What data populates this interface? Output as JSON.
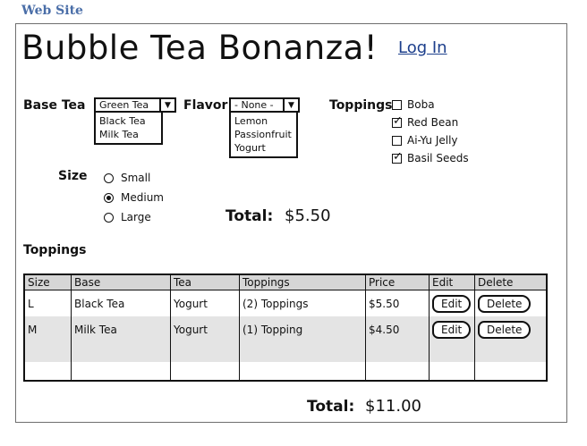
{
  "caption": "Web Site",
  "header": {
    "title": "Bubble Tea Bonanza!",
    "login": "Log In"
  },
  "form": {
    "base_tea": {
      "label": "Base Tea",
      "selected": "Green Tea",
      "options": [
        "Black Tea",
        "Milk Tea"
      ]
    },
    "flavor": {
      "label": "Flavor",
      "selected": "- None -",
      "options": [
        "Lemon",
        "Passionfruit",
        "Yogurt"
      ]
    },
    "toppings": {
      "label": "Toppings",
      "items": [
        {
          "label": "Boba",
          "checked": false
        },
        {
          "label": "Red Bean",
          "checked": true
        },
        {
          "label": "Ai-Yu Jelly",
          "checked": false
        },
        {
          "label": "Basil Seeds",
          "checked": true
        }
      ]
    },
    "size": {
      "label": "Size",
      "options": [
        {
          "label": "Small",
          "selected": false
        },
        {
          "label": "Medium",
          "selected": true
        },
        {
          "label": "Large",
          "selected": false
        }
      ]
    },
    "total_label": "Total:",
    "total_value": "$5.50"
  },
  "order": {
    "section_label": "Toppings",
    "columns": [
      "Size",
      "Base",
      "Tea",
      "Toppings",
      "Price",
      "Edit",
      "Delete"
    ],
    "rows": [
      {
        "size": "L",
        "base": "Black Tea",
        "tea": "Yogurt",
        "toppings": "(2) Toppings",
        "price": "$5.50",
        "edit": "Edit",
        "delete": "Delete"
      },
      {
        "size": "M",
        "base": "Milk Tea",
        "tea": "Yogurt",
        "toppings": "(1) Topping",
        "price": "$4.50",
        "edit": "Edit",
        "delete": "Delete"
      }
    ],
    "total_label": "Total:",
    "total_value": "$11.00"
  }
}
